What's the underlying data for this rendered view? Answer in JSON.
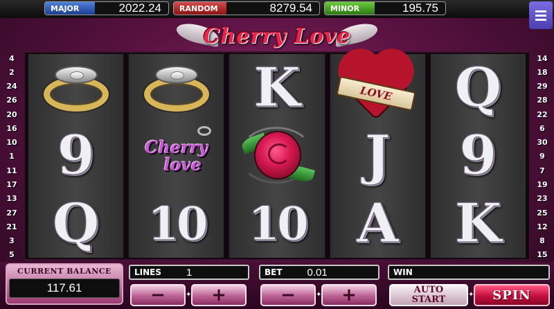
{
  "jackpots": {
    "major": {
      "label": "MAJOR",
      "value": "2022.24"
    },
    "random": {
      "label": "RANDOM",
      "value": "8279.54"
    },
    "minor": {
      "label": "MINOR",
      "value": "195.75"
    }
  },
  "logo": {
    "title": "Cherry Love"
  },
  "menu": {
    "icon": "menu-icon"
  },
  "paylines": {
    "left": [
      "4",
      "2",
      "24",
      "26",
      "20",
      "16",
      "10",
      "1",
      "11",
      "17",
      "13",
      "27",
      "21",
      "3",
      "5"
    ],
    "right": [
      "14",
      "18",
      "29",
      "28",
      "22",
      "6",
      "30",
      "9",
      "7",
      "19",
      "23",
      "25",
      "12",
      "8",
      "15"
    ],
    "active_left": "1"
  },
  "reels": [
    [
      {
        "kind": "ring",
        "icon": "gold-ring-icon"
      },
      {
        "kind": "glyph",
        "text": "9"
      },
      {
        "kind": "glyph",
        "text": "Q"
      }
    ],
    [
      {
        "kind": "ring",
        "icon": "gold-ring-icon"
      },
      {
        "kind": "cherrylove",
        "text1": "Cherry",
        "text2": "love",
        "icon": "cherry-love-logo-icon"
      },
      {
        "kind": "glyph",
        "text": "10"
      }
    ],
    [
      {
        "kind": "glyph",
        "text": "K"
      },
      {
        "kind": "rose",
        "icon": "rose-icon"
      },
      {
        "kind": "glyph",
        "text": "10"
      }
    ],
    [
      {
        "kind": "heart",
        "text": "LOVE",
        "icon": "heart-love-icon"
      },
      {
        "kind": "glyph",
        "text": "J"
      },
      {
        "kind": "glyph",
        "text": "A"
      }
    ],
    [
      {
        "kind": "glyph",
        "text": "Q"
      },
      {
        "kind": "glyph",
        "text": "9"
      },
      {
        "kind": "glyph",
        "text": "K"
      }
    ]
  ],
  "controls": {
    "balance_label": "CURRENT BALANCE",
    "balance_value": "117.61",
    "lines_label": "LINES",
    "lines_value": "1",
    "bet_label": "BET",
    "bet_value": "0.01",
    "win_label": "WIN",
    "win_value": "",
    "minus": "−",
    "plus": "+",
    "auto_line1": "AUTO",
    "auto_line2": "START",
    "spin": "SPIN"
  }
}
